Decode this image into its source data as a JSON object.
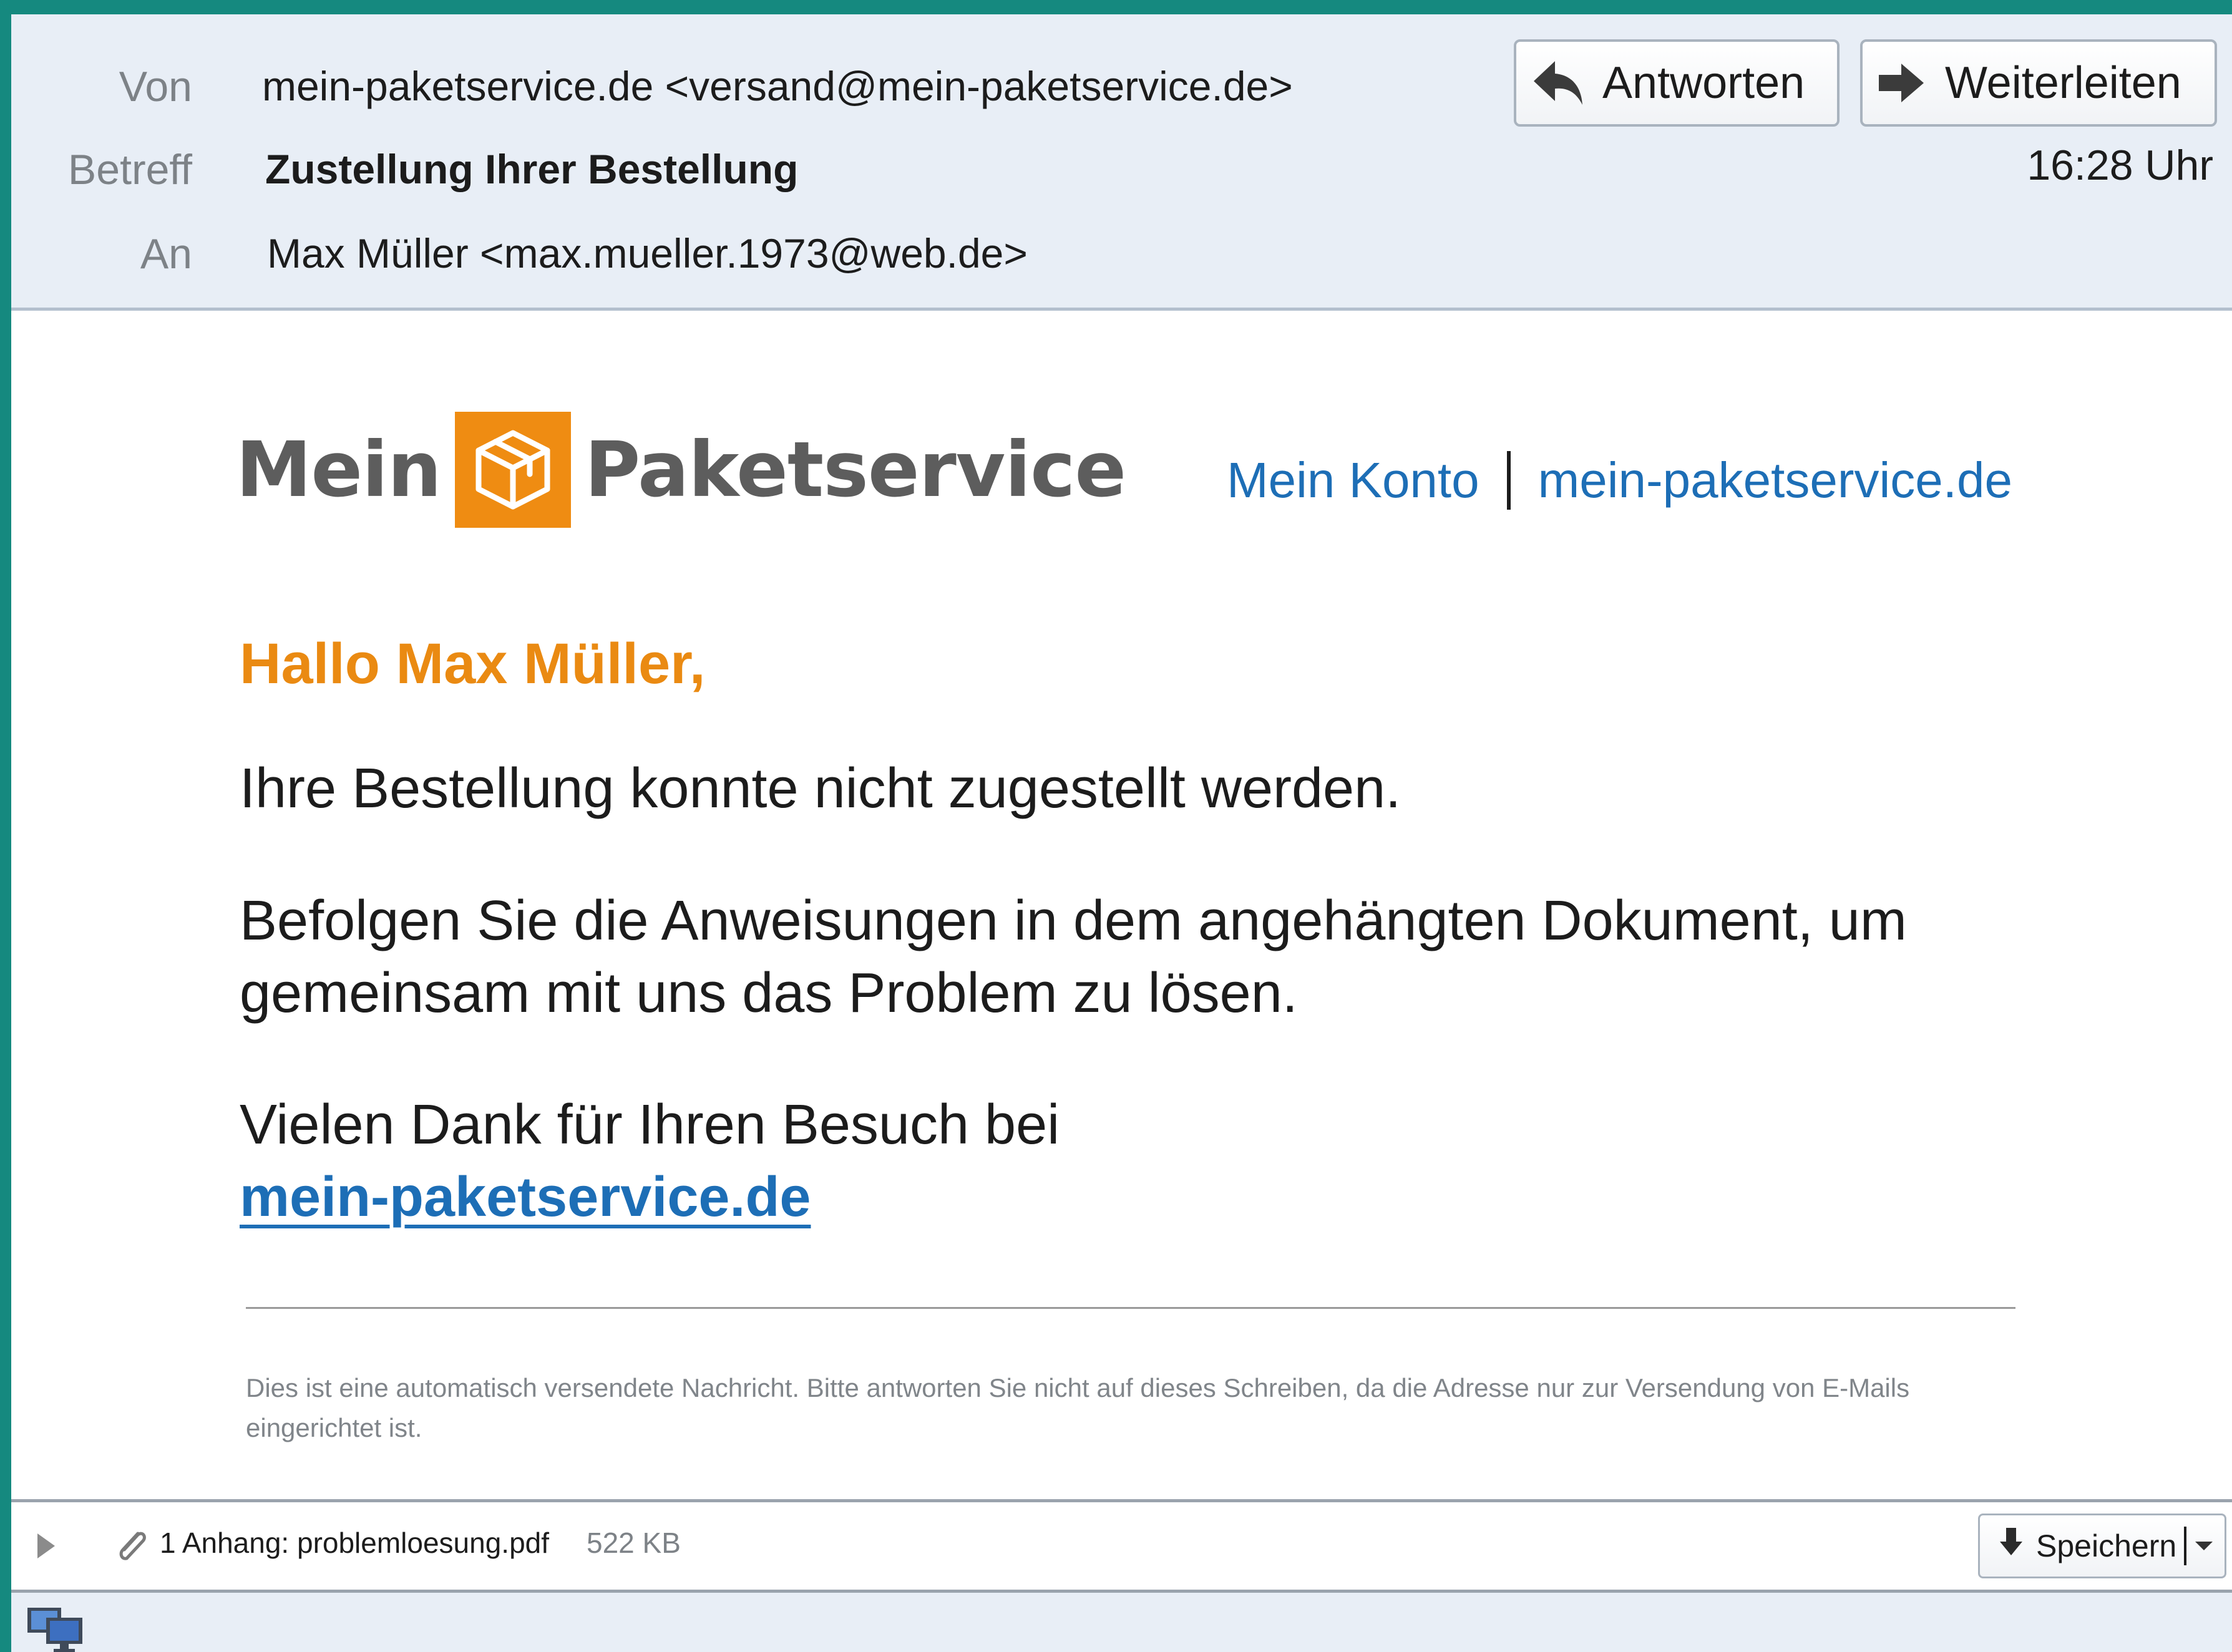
{
  "header": {
    "from_label": "Von",
    "from_value": "mein-paketservice.de <versand@mein-paketservice.de>",
    "subject_label": "Betreff",
    "subject_value": "Zustellung Ihrer Bestellung",
    "to_label": "An",
    "to_value": "Max Müller <max.mueller.1973@web.de>",
    "reply_label": "Antworten",
    "forward_label": "Weiterleiten",
    "time": "16:28 Uhr"
  },
  "brand": {
    "word1": "Mein",
    "word2": "Paketservice",
    "color_orange": "#ef8c12",
    "color_gray": "#5d5d5d",
    "icon": "package-icon"
  },
  "nav": {
    "account_label": "Mein Konto",
    "site_label": "mein-paketservice.de",
    "link_color": "#1d6eb6"
  },
  "message": {
    "greeting": "Hallo Max Müller,",
    "p1": "Ihre Bestellung konnte nicht zugestellt werden.",
    "p2": "Befolgen Sie die Anweisungen in dem angehängten Dokument, um gemeinsam mit uns das Problem zu lösen.",
    "p3": "Vielen Dank für Ihren Besuch bei",
    "p3_link": "mein-paketservice.de",
    "footer": "Dies ist eine automatisch versendete Nachricht. Bitte antworten Sie nicht auf dieses Schreiben, da die Adresse nur zur Versendung von E-Mails eingerichtet ist."
  },
  "attachment": {
    "label": "1 Anhang: problemloesung.pdf",
    "size": "522 KB",
    "save_label": "Speichern"
  },
  "icons": {
    "reply": "reply-arrow-icon",
    "forward": "forward-arrow-icon",
    "expand": "expand-triangle-icon",
    "attachment": "paperclip-icon",
    "download": "download-arrow-icon",
    "dropdown": "dropdown-arrow-icon",
    "network": "network-status-icon"
  }
}
